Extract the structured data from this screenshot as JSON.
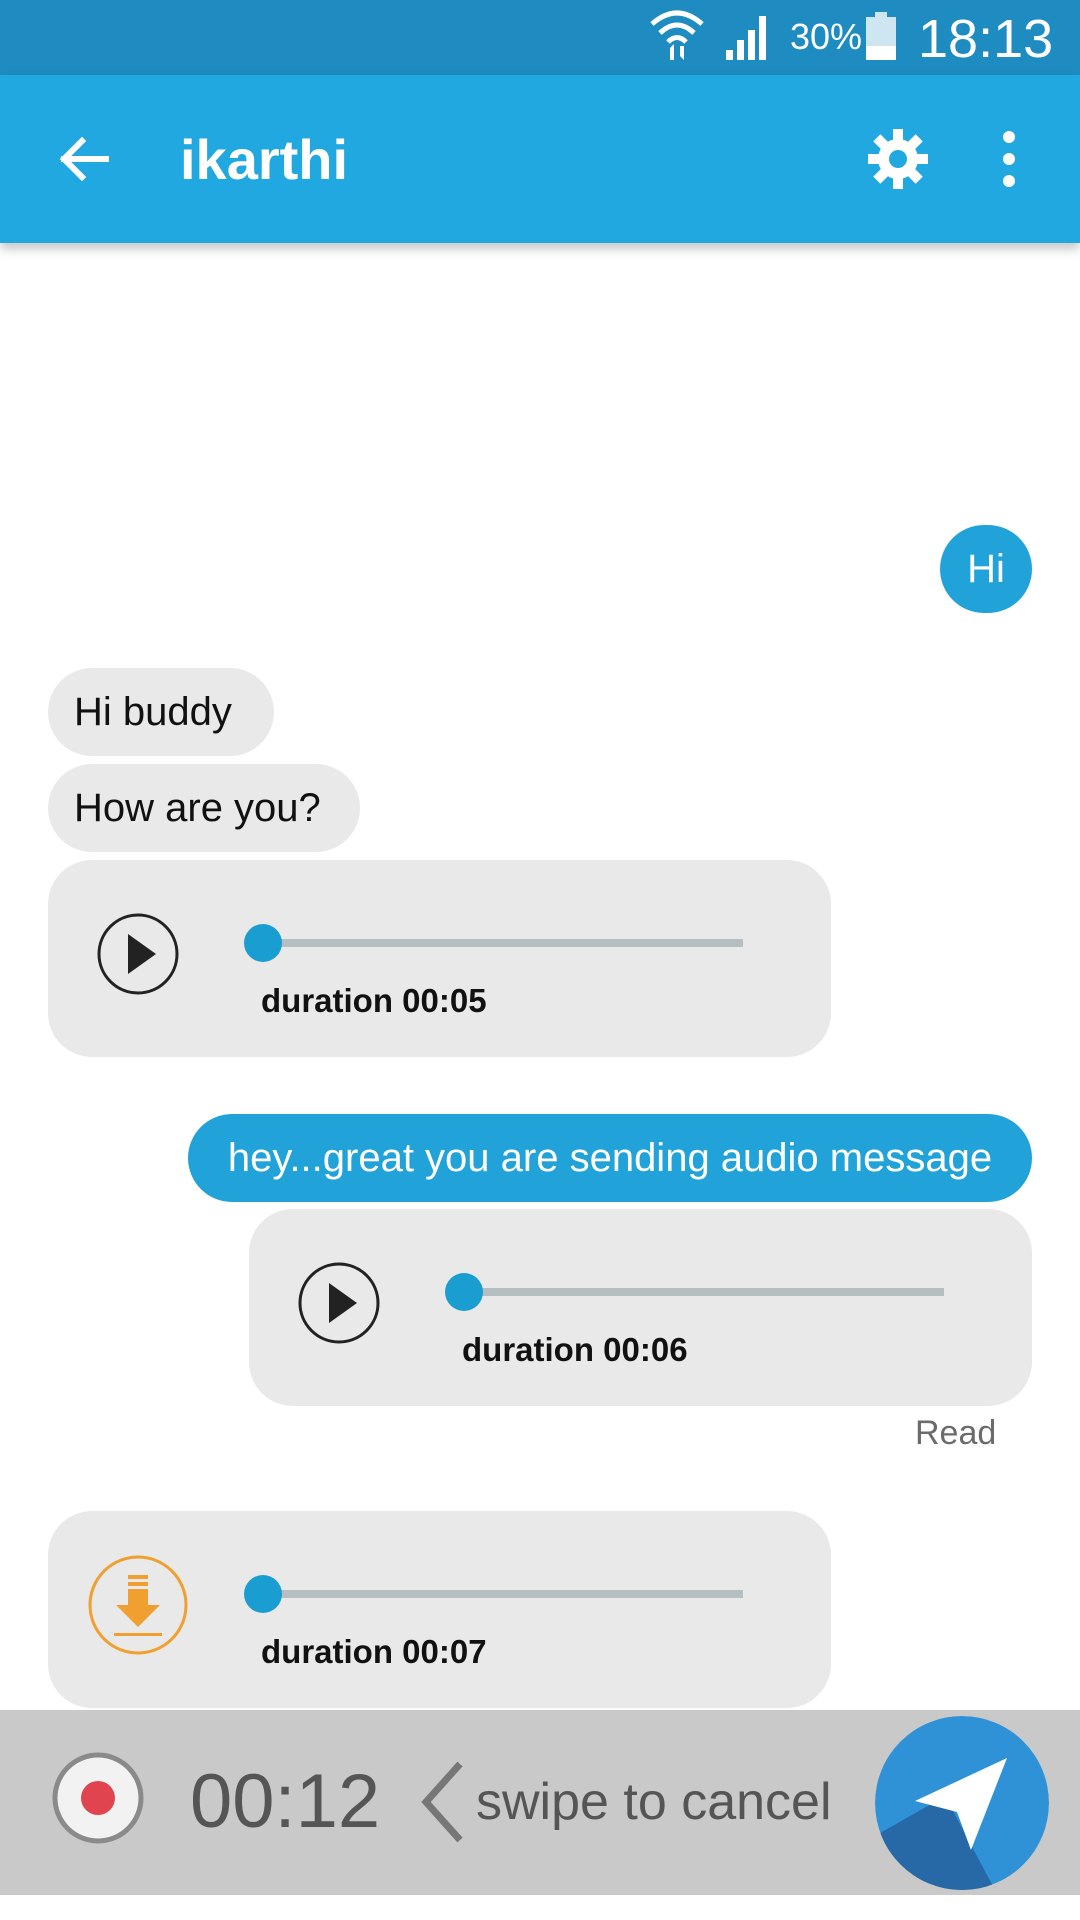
{
  "status_bar": {
    "battery_percent": "30%",
    "time": "18:13"
  },
  "app_bar": {
    "title": "ikarthi"
  },
  "messages": {
    "out_hi": "Hi",
    "in_hi_buddy": "Hi buddy",
    "in_how_are_you": "How are you?",
    "audio1": {
      "duration": "duration 00:05",
      "progress": 0
    },
    "out_hey": "hey...great you are sending audio message",
    "audio2": {
      "duration": "duration 00:06",
      "progress": 0
    },
    "read_status": "Read",
    "audio3": {
      "duration": "duration 00:07",
      "progress": 0
    }
  },
  "recording": {
    "timer": "00:12",
    "swipe_hint": "swipe to cancel"
  },
  "colors": {
    "status_bar": "#1e8cc0",
    "app_bar": "#22a8e0",
    "outgoing_bubble": "#21a3d9",
    "incoming_bubble": "#e9e9e9",
    "download_accent": "#f0a030",
    "record_red": "#e0454f",
    "send_blue": "#2f92d6"
  },
  "icons": {
    "back": "arrow-left-icon",
    "settings": "gear-icon",
    "more": "more-vertical-icon",
    "play": "play-icon",
    "download": "download-icon",
    "record": "record-icon",
    "send": "send-icon"
  }
}
